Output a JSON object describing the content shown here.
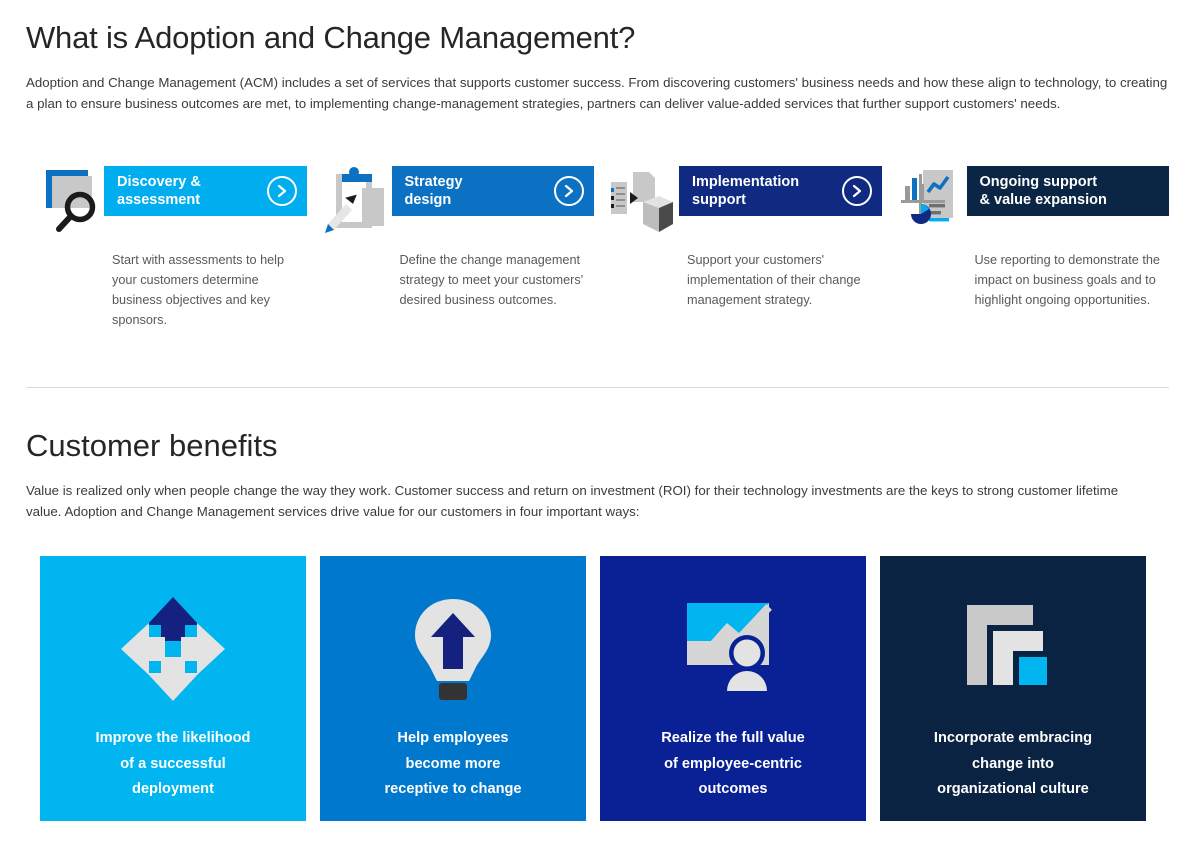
{
  "section_one": {
    "title": "What is Adoption and Change Management?",
    "paragraph": "Adoption and Change Management (ACM) includes a set of services that supports customer success. From discovering customers' business needs and how these align to technology, to creating a plan to ensure business outcomes are met, to implementing change-management strategies, partners can deliver value-added services that further support customers' needs.",
    "cards": [
      {
        "icon": "screen-magnifier-icon",
        "title": "Discovery &\nassessment",
        "title_line1": "Discovery &",
        "title_line2": "assessment",
        "description": "Start with assessments to help your customers determine business objectives and key sponsors.",
        "header_color": "#00AEEF",
        "has_chevron": true
      },
      {
        "icon": "clipboard-pen-icon",
        "title_line1": "Strategy",
        "title_line2": "design",
        "description": "Define the change management strategy to meet your customers' desired business outcomes.",
        "header_color": "#0C71C3",
        "has_chevron": true
      },
      {
        "icon": "box-documents-icon",
        "title_line1": "Implementation",
        "title_line2": "support",
        "description": "Support your customers' implementation of their change management strategy.",
        "header_color": "#0F2A80",
        "has_chevron": true
      },
      {
        "icon": "dashboard-report-icon",
        "title_line1": "Ongoing support",
        "title_line2": "& value expansion",
        "description": "Use reporting to demonstrate the impact on business goals and to highlight ongoing opportunities.",
        "header_color": "#0B2545",
        "has_chevron": false
      }
    ]
  },
  "section_two": {
    "title": "Customer benefits",
    "paragraph": "Value is realized only when people change the way they work. Customer success and return on investment (ROI) for their technology investments are the keys to strong customer lifetime value. Adoption and Change Management services drive value for our customers in four important ways:",
    "tiles": [
      {
        "icon": "four-way-arrows-icon",
        "label_line1": "Improve the likelihood",
        "label_line2": "of a successful",
        "label_line3": "deployment",
        "bg_color": "#00B5F0"
      },
      {
        "icon": "lightbulb-up-arrow-icon",
        "label_line1": "Help employees",
        "label_line2": "become more",
        "label_line3": "receptive to change",
        "bg_color": "#0078CE"
      },
      {
        "icon": "chart-person-icon",
        "label_line1": "Realize the full value",
        "label_line2": "of employee-centric",
        "label_line3": "outcomes",
        "bg_color": "#0A2196"
      },
      {
        "icon": "nested-corners-icon",
        "label_line1": "Incorporate embracing",
        "label_line2": "change into",
        "label_line3": "organizational culture",
        "bg_color": "#0A2342"
      }
    ]
  },
  "colors": {
    "accent_cyan": "#00AEEF",
    "accent_blue": "#0C71C3",
    "accent_navy": "#0F2A80",
    "accent_dark_navy": "#0B2545",
    "text": "#3b3b3b",
    "muted": "#58595b",
    "divider": "#d8d8d8"
  }
}
